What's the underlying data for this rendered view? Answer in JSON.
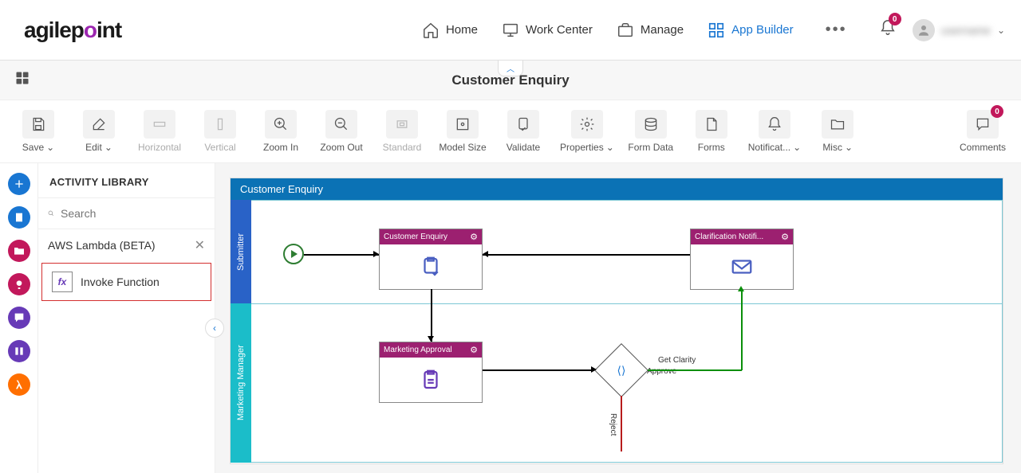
{
  "logo": {
    "text": "agilepoint"
  },
  "nav": {
    "home": "Home",
    "workcenter": "Work Center",
    "manage": "Manage",
    "appbuilder": "App Builder"
  },
  "notifications": {
    "count": "0"
  },
  "user": {
    "name": "username"
  },
  "page": {
    "title": "Customer Enquiry"
  },
  "toolbar": {
    "save": "Save",
    "edit": "Edit",
    "horizontal": "Horizontal",
    "vertical": "Vertical",
    "zoomin": "Zoom In",
    "zoomout": "Zoom Out",
    "standard": "Standard",
    "modelsize": "Model Size",
    "validate": "Validate",
    "properties": "Properties",
    "formdata": "Form Data",
    "forms": "Forms",
    "notifications": "Notificat...",
    "misc": "Misc",
    "comments": "Comments",
    "comments_count": "0"
  },
  "panel": {
    "title": "ACTIVITY LIBRARY",
    "search_placeholder": "Search",
    "category": "AWS Lambda (BETA)",
    "activity": {
      "label": "Invoke Function",
      "icon": "fx"
    }
  },
  "process": {
    "title": "Customer Enquiry",
    "lanes": {
      "submitter": "Submitter",
      "marketing": "Marketing Manager"
    },
    "tasks": {
      "customer_enquiry": "Customer Enquiry",
      "clarification": "Clarification Notifi...",
      "marketing_approval": "Marketing Approval"
    },
    "edges": {
      "get_clarity": "Get Clarity",
      "approve": "Approve",
      "reject": "Reject"
    }
  }
}
